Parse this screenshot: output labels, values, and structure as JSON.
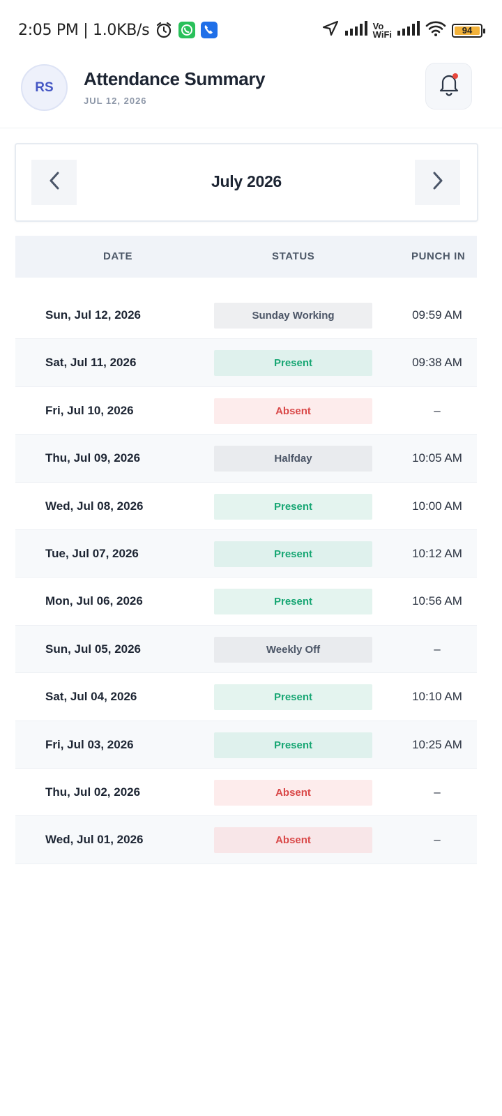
{
  "status_bar": {
    "time": "2:05 PM | 1.0KB/s",
    "vo_line1": "Vo",
    "vo_line2": "WiFi",
    "battery_level": "94"
  },
  "header": {
    "avatar_initials": "RS",
    "title": "Attendance Summary",
    "date": "JUL 12, 2026"
  },
  "month_nav": {
    "label": "July 2026"
  },
  "table": {
    "columns": {
      "date": "DATE",
      "status": "STATUS",
      "punch_in": "PUNCH IN"
    },
    "rows": [
      {
        "date": "Sun, Jul 12, 2026",
        "status": "Sunday Working",
        "punch_in": "09:59 AM"
      },
      {
        "date": "Sat, Jul 11, 2026",
        "status": "Present",
        "punch_in": "09:38 AM"
      },
      {
        "date": "Fri, Jul 10, 2026",
        "status": "Absent",
        "punch_in": "–"
      },
      {
        "date": "Thu, Jul 09, 2026",
        "status": "Halfday",
        "punch_in": "10:05 AM"
      },
      {
        "date": "Wed, Jul 08, 2026",
        "status": "Present",
        "punch_in": "10:00 AM"
      },
      {
        "date": "Tue, Jul 07, 2026",
        "status": "Present",
        "punch_in": "10:12 AM"
      },
      {
        "date": "Mon, Jul 06, 2026",
        "status": "Present",
        "punch_in": "10:56 AM"
      },
      {
        "date": "Sun, Jul 05, 2026",
        "status": "Weekly Off",
        "punch_in": "–"
      },
      {
        "date": "Sat, Jul 04, 2026",
        "status": "Present",
        "punch_in": "10:10 AM"
      },
      {
        "date": "Fri, Jul 03, 2026",
        "status": "Present",
        "punch_in": "10:25 AM"
      },
      {
        "date": "Thu, Jul 02, 2026",
        "status": "Absent",
        "punch_in": "–"
      },
      {
        "date": "Wed, Jul 01, 2026",
        "status": "Absent",
        "punch_in": "–"
      }
    ]
  },
  "colors": {
    "present": "#17a673",
    "absent": "#d94848",
    "neutral": "#4b5566",
    "accent": "#4456c4",
    "notification_dot": "#e8473c"
  }
}
